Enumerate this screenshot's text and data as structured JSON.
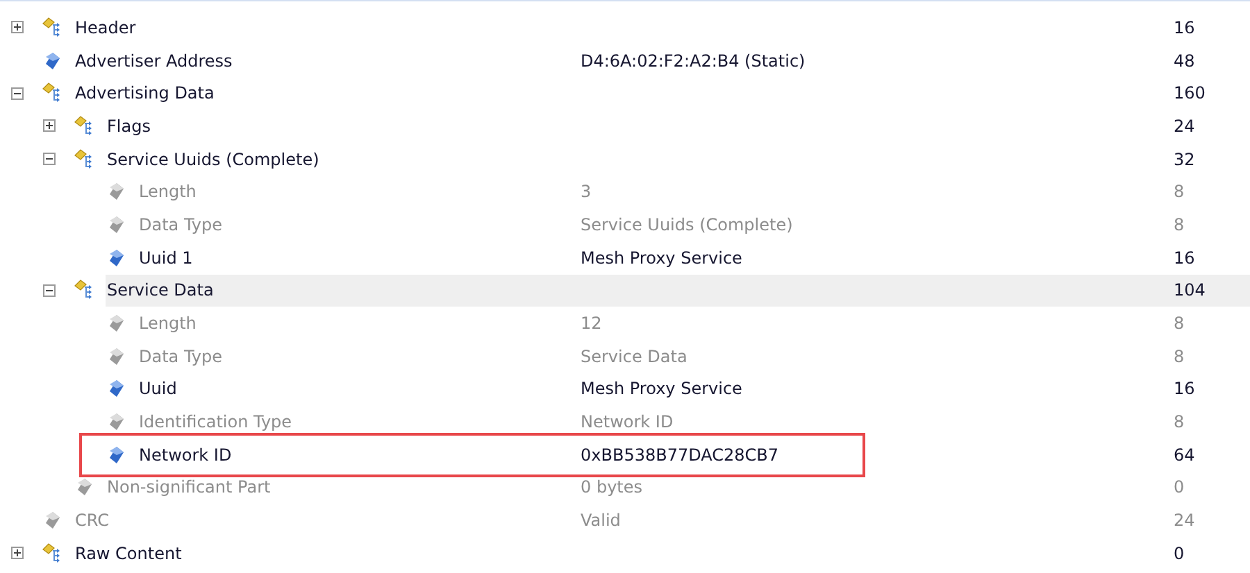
{
  "tree": [
    {
      "name": "Header",
      "size": "16",
      "kind": "group",
      "expanded": false,
      "selected": false
    },
    {
      "name": "Advertiser Address",
      "value": "D4:6A:02:F2:A2:B4 (Static)",
      "size": "48",
      "kind": "field",
      "selected": false
    },
    {
      "name": "Advertising Data",
      "size": "160",
      "kind": "group",
      "expanded": true,
      "selected": false,
      "children": [
        {
          "name": "Flags",
          "size": "24",
          "kind": "group",
          "expanded": false,
          "selected": false
        },
        {
          "name": "Service Uuids (Complete)",
          "size": "32",
          "kind": "group",
          "expanded": true,
          "selected": false,
          "children": [
            {
              "name": "Length",
              "value": "3",
              "size": "8",
              "kind": "meta",
              "selected": false
            },
            {
              "name": "Data Type",
              "value": "Service Uuids (Complete)",
              "size": "8",
              "kind": "meta",
              "selected": false
            },
            {
              "name": "Uuid 1",
              "value": "Mesh Proxy Service",
              "size": "16",
              "kind": "field",
              "selected": false
            }
          ]
        },
        {
          "name": "Service Data",
          "size": "104",
          "kind": "group",
          "expanded": true,
          "selected": true,
          "children": [
            {
              "name": "Length",
              "value": "12",
              "size": "8",
              "kind": "meta",
              "selected": false
            },
            {
              "name": "Data Type",
              "value": "Service Data",
              "size": "8",
              "kind": "meta",
              "selected": false
            },
            {
              "name": "Uuid",
              "value": "Mesh Proxy Service",
              "size": "16",
              "kind": "field",
              "selected": false
            },
            {
              "name": "Identification Type",
              "value": "Network ID",
              "size": "8",
              "kind": "meta",
              "selected": false
            },
            {
              "name": "Network ID",
              "value": "0xBB538B77DAC28CB7",
              "size": "64",
              "kind": "field",
              "selected": false,
              "highlighted": true
            }
          ]
        },
        {
          "name": "Non-significant Part",
          "value": "0 bytes",
          "size": "0",
          "kind": "meta",
          "selected": false
        }
      ]
    },
    {
      "name": "CRC",
      "value": "Valid",
      "size": "24",
      "kind": "meta",
      "selected": false
    },
    {
      "name": "Raw Content",
      "size": "0",
      "kind": "group",
      "expanded": false,
      "selected": false
    }
  ]
}
